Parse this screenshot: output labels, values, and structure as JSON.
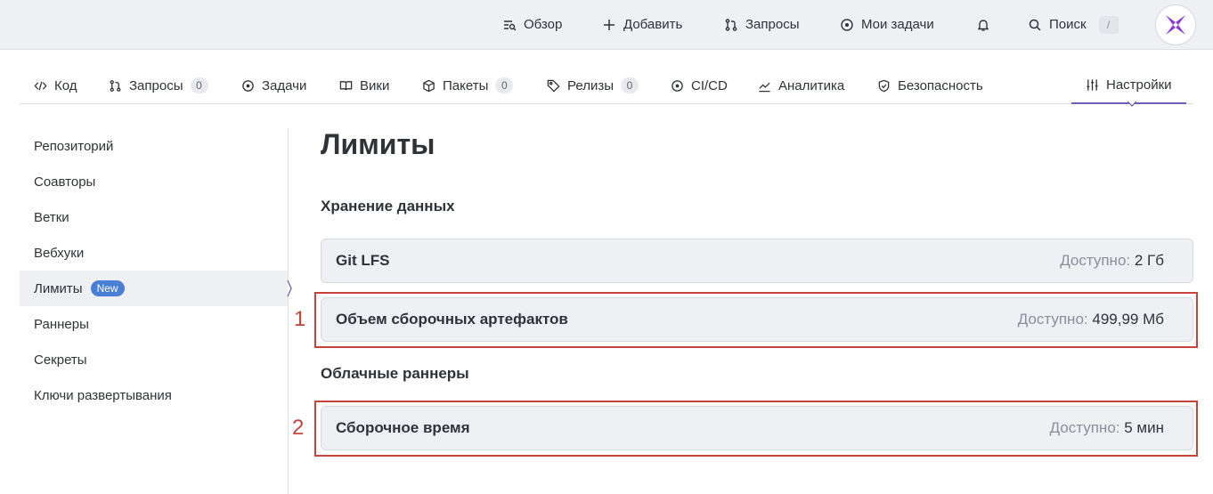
{
  "topbar": {
    "overview": "Обзор",
    "add": "Добавить",
    "requests": "Запросы",
    "my_tasks": "Мои задачи",
    "search": "Поиск",
    "search_shortcut": "/"
  },
  "tabs": [
    {
      "label": "Код"
    },
    {
      "label": "Запросы",
      "count": "0"
    },
    {
      "label": "Задачи"
    },
    {
      "label": "Вики"
    },
    {
      "label": "Пакеты",
      "count": "0"
    },
    {
      "label": "Релизы",
      "count": "0"
    },
    {
      "label": "CI/CD"
    },
    {
      "label": "Аналитика"
    },
    {
      "label": "Безопасность"
    },
    {
      "label": "Настройки",
      "active": true
    }
  ],
  "sidebar": {
    "items": [
      {
        "label": "Репозиторий"
      },
      {
        "label": "Соавторы"
      },
      {
        "label": "Ветки"
      },
      {
        "label": "Вебхуки"
      },
      {
        "label": "Лимиты",
        "badge": "New",
        "active": true
      },
      {
        "label": "Раннеры"
      },
      {
        "label": "Секреты"
      },
      {
        "label": "Ключи развертывания"
      }
    ]
  },
  "main": {
    "title": "Лимиты",
    "sections": [
      {
        "title": "Хранение данных",
        "rows": [
          {
            "name": "Git LFS",
            "avail_label": "Доступно:",
            "avail_value": "2 Гб"
          },
          {
            "name": "Объем сборочных артефактов",
            "avail_label": "Доступно:",
            "avail_value": "499,99 Мб"
          }
        ]
      },
      {
        "title": "Облачные раннеры",
        "rows": [
          {
            "name": "Сборочное время",
            "avail_label": "Доступно:",
            "avail_value": "5 мин"
          }
        ]
      }
    ]
  },
  "annotations": [
    "1",
    "2"
  ],
  "colors": {
    "accent": "#6b5fb5",
    "badge": "#4a7fd6",
    "highlight": "#c5433b",
    "row_bg": "#eef0f3",
    "logo": "#8e3fd0"
  }
}
